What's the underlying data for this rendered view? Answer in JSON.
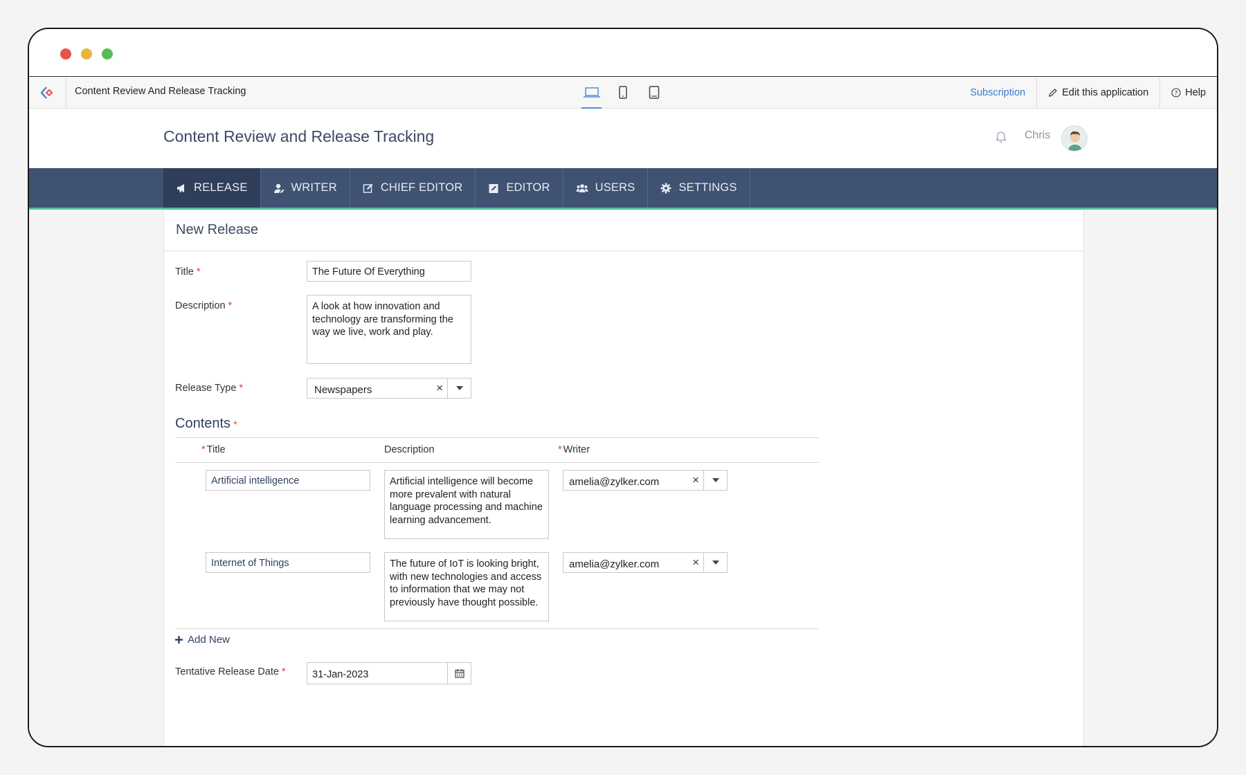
{
  "appbar": {
    "app_name": "Content Review And Release Tracking",
    "subscription": "Subscription",
    "edit_app": "Edit this application",
    "help": "Help"
  },
  "header": {
    "title": "Content Review and Release Tracking",
    "user": "Chris"
  },
  "nav": {
    "items": [
      {
        "label": "RELEASE",
        "icon": "megaphone-icon"
      },
      {
        "label": "WRITER",
        "icon": "user-edit-icon"
      },
      {
        "label": "CHIEF EDITOR",
        "icon": "edit-box-icon"
      },
      {
        "label": "EDITOR",
        "icon": "pencil-square-icon"
      },
      {
        "label": "USERS",
        "icon": "users-icon"
      },
      {
        "label": "SETTINGS",
        "icon": "gear-icon"
      }
    ]
  },
  "form": {
    "heading": "New Release",
    "title_label": "Title",
    "title_value": "The Future Of Everything",
    "description_label": "Description",
    "description_value": "A look at how innovation and technology are transforming the way we live, work and play.",
    "release_type_label": "Release Type",
    "release_type_value": "Newspapers",
    "contents_label": "Contents",
    "columns": {
      "title": "Title",
      "description": "Description",
      "writer": "Writer"
    },
    "rows": [
      {
        "title": "Artificial intelligence",
        "description": "Artificial intelligence will become more prevalent with natural language processing and machine learning advancement.",
        "writer": "amelia@zylker.com"
      },
      {
        "title": "Internet of Things",
        "description": "The future of IoT is looking bright, with new technologies and access to information that we may not previously have thought possible.",
        "writer": "amelia@zylker.com"
      }
    ],
    "add_new": "Add New",
    "release_date_label": "Tentative Release Date",
    "release_date_value": "31-Jan-2023"
  },
  "colors": {
    "nav_bg": "#3f5272",
    "nav_active": "#2f3f5a",
    "accent": "#4fc1a0",
    "link": "#3a7cc5",
    "required": "#e23c3c"
  }
}
